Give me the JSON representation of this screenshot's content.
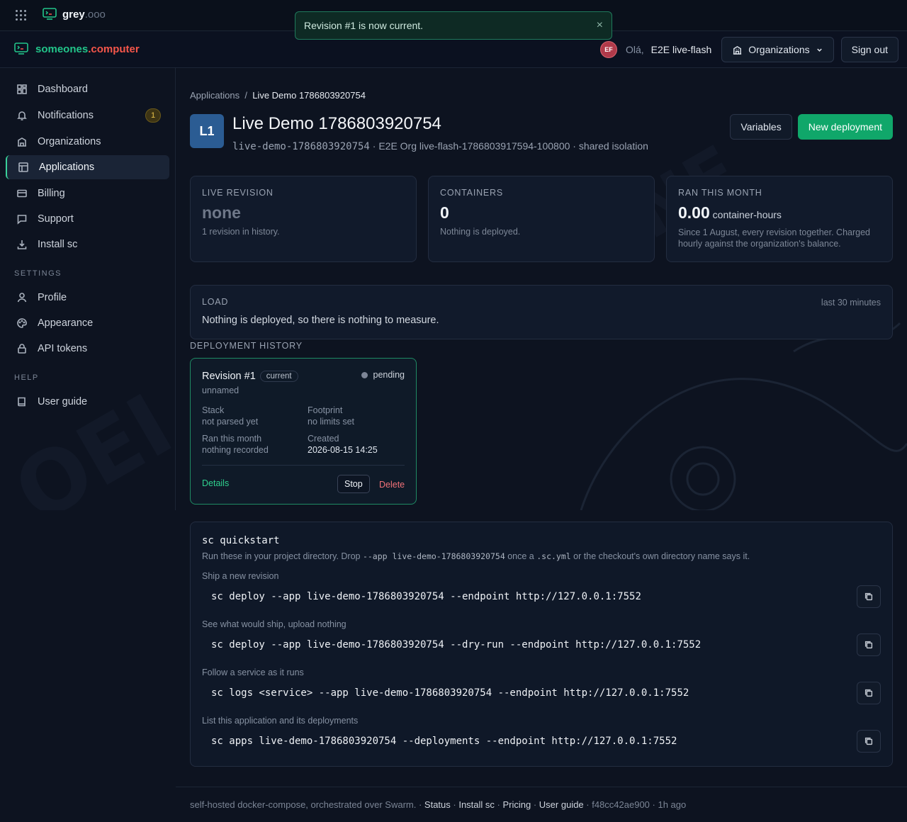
{
  "topbar": {
    "brand": "grey",
    "brand_suffix": ".ooo"
  },
  "toast": {
    "message": "Revision #1 is now current.",
    "close": "×"
  },
  "header": {
    "logo_a": "someones",
    "logo_dot": ".",
    "logo_b": "computer",
    "avatar": "EF",
    "greeting": "Olá,",
    "user": "E2E live-flash",
    "organizations": "Organizations",
    "sign_out": "Sign out"
  },
  "sidebar": {
    "items": [
      {
        "label": "Dashboard"
      },
      {
        "label": "Notifications",
        "badge": "1"
      },
      {
        "label": "Organizations"
      },
      {
        "label": "Applications"
      },
      {
        "label": "Billing"
      },
      {
        "label": "Support"
      },
      {
        "label": "Install sc"
      }
    ],
    "settings_heading": "SETTINGS",
    "settings": [
      {
        "label": "Profile"
      },
      {
        "label": "Appearance"
      },
      {
        "label": "API tokens"
      }
    ],
    "help_heading": "HELP",
    "help": [
      {
        "label": "User guide"
      }
    ]
  },
  "breadcrumb": {
    "parent": "Applications",
    "sep": "/",
    "current": "Live Demo 1786803920754"
  },
  "app": {
    "icon": "L1",
    "title": "Live Demo 1786803920754",
    "slug": "live-demo-1786803920754",
    "meta": " · E2E Org live-flash-1786803917594-100800 · shared isolation",
    "variables": "Variables",
    "new_deployment": "New deployment"
  },
  "stats": [
    {
      "label": "LIVE REVISION",
      "value": "none",
      "unit": "",
      "note": "1 revision in history."
    },
    {
      "label": "CONTAINERS",
      "value": "0",
      "unit": "",
      "note": "Nothing is deployed."
    },
    {
      "label": "RAN THIS MONTH",
      "value": "0.00",
      "unit": "container-hours",
      "note": "Since 1 August, every revision together. Charged hourly against the organization's balance."
    }
  ],
  "load": {
    "label": "LOAD",
    "range": "last 30 minutes",
    "message": "Nothing is deployed, so there is nothing to measure."
  },
  "history": {
    "heading": "DEPLOYMENT HISTORY",
    "revision": {
      "title": "Revision #1",
      "chip": "current",
      "status": "pending",
      "name": "unnamed",
      "stack_label": "Stack",
      "stack_value": "not parsed yet",
      "footprint_label": "Footprint",
      "footprint_value": "no limits set",
      "ran_label": "Ran this month",
      "ran_value": "nothing recorded",
      "created_label": "Created",
      "created_value": "2026-08-15 14:25",
      "details": "Details",
      "stop": "Stop",
      "delete": "Delete"
    }
  },
  "quickstart": {
    "title": "sc quickstart",
    "intro_a": "Run these in your project directory. Drop ",
    "intro_code1": "--app live-demo-1786803920754",
    "intro_b": " once a ",
    "intro_code2": ".sc.yml",
    "intro_c": " or the checkout's own directory name says it.",
    "commands": [
      {
        "label": "Ship a new revision",
        "cmd": "sc deploy --app live-demo-1786803920754 --endpoint http://127.0.0.1:7552"
      },
      {
        "label": "See what would ship, upload nothing",
        "cmd": "sc deploy --app live-demo-1786803920754 --dry-run --endpoint http://127.0.0.1:7552"
      },
      {
        "label": "Follow a service as it runs",
        "cmd": "sc logs <service> --app live-demo-1786803920754 --endpoint http://127.0.0.1:7552"
      },
      {
        "label": "List this application and its deployments",
        "cmd": "sc apps live-demo-1786803920754 --deployments --endpoint http://127.0.0.1:7552"
      }
    ]
  },
  "footer": {
    "text": "self-hosted docker-compose, orchestrated over Swarm.",
    "sep": " · ",
    "links": [
      "Status",
      "Install sc",
      "Pricing",
      "User guide"
    ],
    "commit": "f48cc42ae900",
    "age": "1h ago"
  }
}
